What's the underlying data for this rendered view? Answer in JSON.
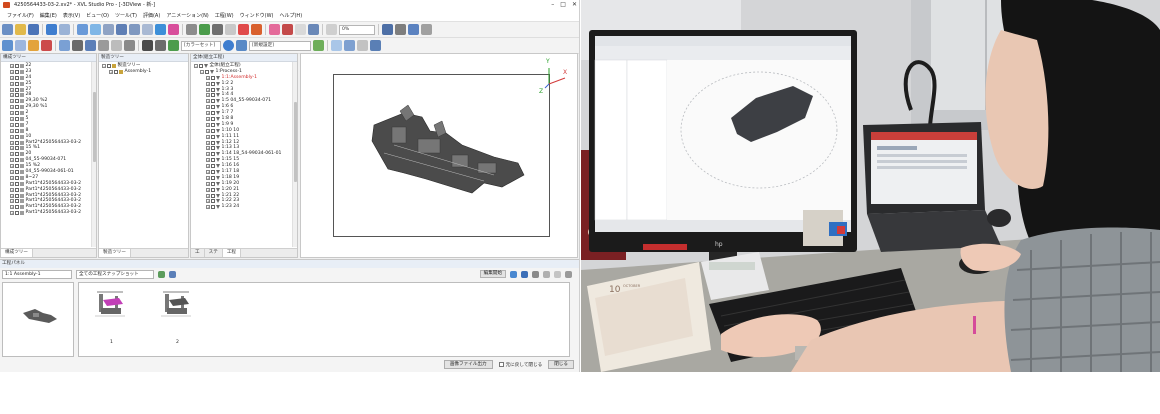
{
  "app": {
    "window_title": "4250564433-03-2.xv2* - XVL Studio Pro - [-3DView - 新-]",
    "menu": [
      "ファイル(F)",
      "編集(E)",
      "表示(V)",
      "ビュー(O)",
      "ツール(T)",
      "評価(A)",
      "アニメーション(N)",
      "工程(W)",
      "ウィンドウ(W)",
      "ヘルプ(H)"
    ],
    "toolbar": {
      "zoom_value": "0%",
      "color_set": "[カラーセット]",
      "new_setting": "[新規設定]"
    },
    "panel_structure": {
      "header": "構成ツリー",
      "items": [
        "22",
        "23",
        "24",
        "25",
        "27",
        "28",
        "29,30 %2",
        "29,30 %1",
        "2",
        "5",
        "7",
        "8",
        "10",
        "Part2*4250564433-03-2",
        "15 %1",
        "20",
        "04_55-99034-071",
        "15 %2",
        "04_55-99034-061-01",
        "8~27",
        "Part1*4250564433-03-2",
        "Part1*4250564433-03-2",
        "Part1*4250564433-03-2",
        "Part1*4250564433-03-2",
        "Part1*4250564433-03-2",
        "Part1*4250564433-03-2"
      ],
      "tab": "構成ツリー"
    },
    "panel_manufacturing": {
      "header": "製造ツリー",
      "root": "製造ツリー",
      "child": "Assembly-1",
      "tab": "製造ツリー"
    },
    "panel_process": {
      "header": "全体(組立工程)",
      "items": [
        "全体(組立工程)",
        "1:Process-1",
        "1:1:Assembly-1",
        "1:2 2",
        "1:3 3",
        "1:4 4",
        "1:5 04_55-99034-071",
        "1:6 6",
        "1:7 7",
        "1:8 8",
        "1:9 9",
        "1:10 10",
        "1:11 11",
        "1:12 12",
        "1:13 13",
        "1:14 18_54-99034-061-01",
        "1:15 15",
        "1:16 16",
        "1:17 18",
        "1:18 19",
        "1:19 20",
        "1:20 21",
        "1:21 22",
        "1:22 23",
        "1:23 24"
      ],
      "tabs": [
        "工",
        "ステ",
        "工程"
      ]
    },
    "view": {
      "axis_y": "Y",
      "axis_x": "X",
      "axis_z": "Z"
    },
    "edit_panel": {
      "header": "工程パネル",
      "assembly_select": "1:1 Assembly-1",
      "snapshot_select": "全ての工程スナップショット",
      "edit_start": "編集開始",
      "snapshots": [
        "1",
        "2"
      ],
      "export_button": "画像ファイル出力",
      "return_checkbox": "元に戻して閉じる",
      "close_button": "閉じる"
    }
  },
  "photo": {
    "monitor_brand": "hp",
    "calendar_month": "10",
    "calendar_label": "OCTOBER",
    "colors": {
      "wall": "#d9dadc",
      "desk": "#a8a7a1",
      "hair": "#141414",
      "monitor_frame": "#1b1b1b",
      "shirt_check": "#8e9498"
    }
  }
}
